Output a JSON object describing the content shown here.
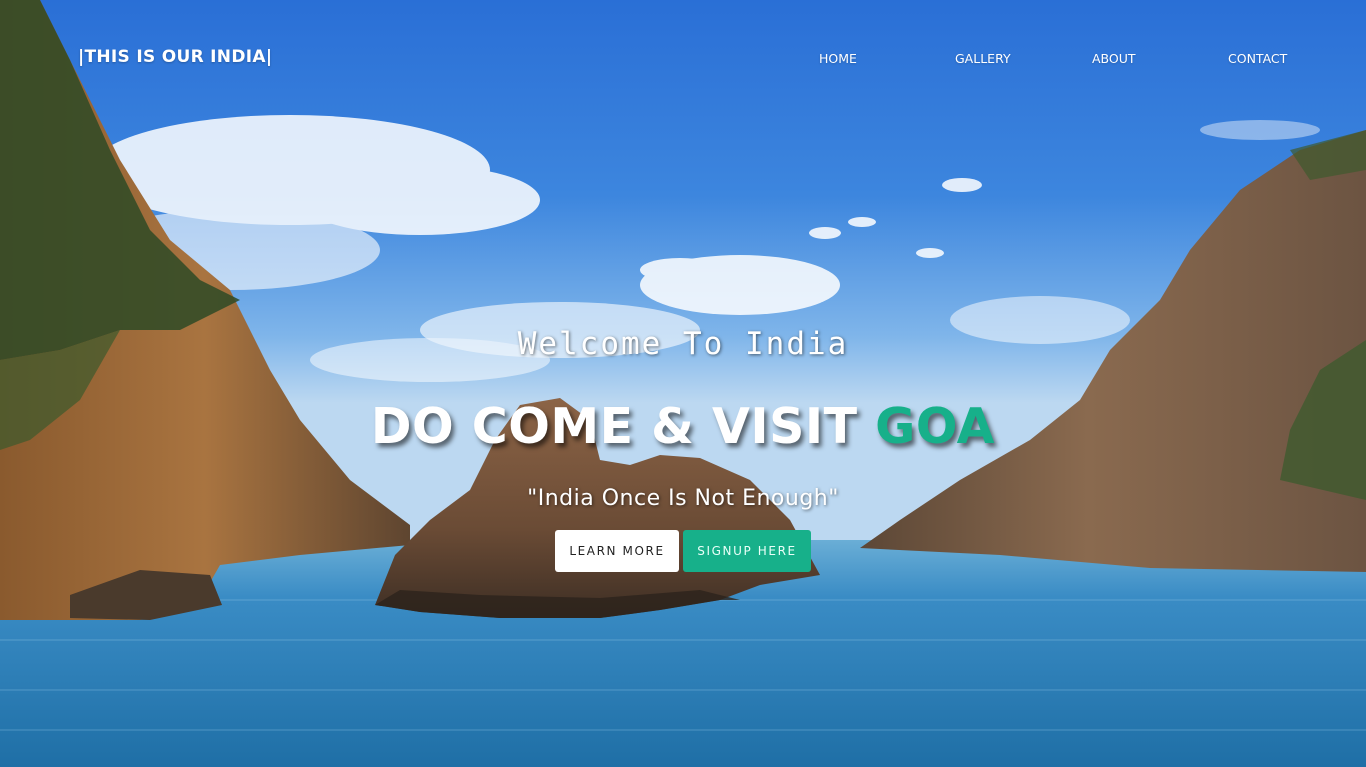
{
  "brand": {
    "text": "|THIS IS OUR INDIA|"
  },
  "nav": {
    "home": "HOME",
    "gallery": "GALLERY",
    "about": "ABOUT",
    "contact": "CONTACT"
  },
  "hero": {
    "welcome": "Welcome To India",
    "headline_main": "DO COME & VISIT ",
    "headline_accent": "GOA",
    "tagline": "\"India Once Is Not Enough\"",
    "learn_more": "LEARN MORE",
    "signup": "SIGNUP HERE"
  },
  "colors": {
    "accent": "#17b08a",
    "text": "#ffffff",
    "sky_top": "#2f74d8",
    "sea": "#2a79b5"
  }
}
